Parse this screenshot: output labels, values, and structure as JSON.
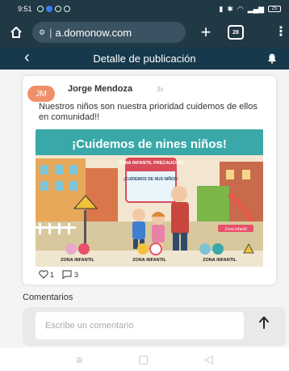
{
  "status_bar": {
    "time": "9:51",
    "battery": "25"
  },
  "browser": {
    "url": "a.domonow.com",
    "tabs_count": "28"
  },
  "header": {
    "title": "Detalle de publicación"
  },
  "post": {
    "avatar_initials": "JM",
    "author": "Jorge Mendoza",
    "time_ago": "3s",
    "text": "Nuestros niños son nuestra prioridad cuidemos de ellos en comunidad!!",
    "image": {
      "headline": "¡Cuidemos de nines niños!",
      "sign_title": "ZONA INFANTIL PRECAUCION",
      "sign_sub": "¡CUIDEMOS DE NUS NIÑOS!",
      "chip": "Zona infantil",
      "footer_labels": [
        "ZONA INFANTIL",
        "ZONA INFANTIL",
        "ZONA INFANTIL"
      ]
    },
    "likes": "1",
    "comments": "3"
  },
  "comments_section": {
    "label": "Comentarios",
    "placeholder": "Escribe un comentario"
  },
  "colors": {
    "header_bg": "#163a4c",
    "avatar": "#f0906a",
    "accent": "#e8506a"
  },
  "icons": [
    "home-icon",
    "tune-icon",
    "plus-icon",
    "tabs-icon",
    "menu-icon",
    "back-icon",
    "bell-icon",
    "heart-icon",
    "comment-icon",
    "send-arrow-icon"
  ]
}
